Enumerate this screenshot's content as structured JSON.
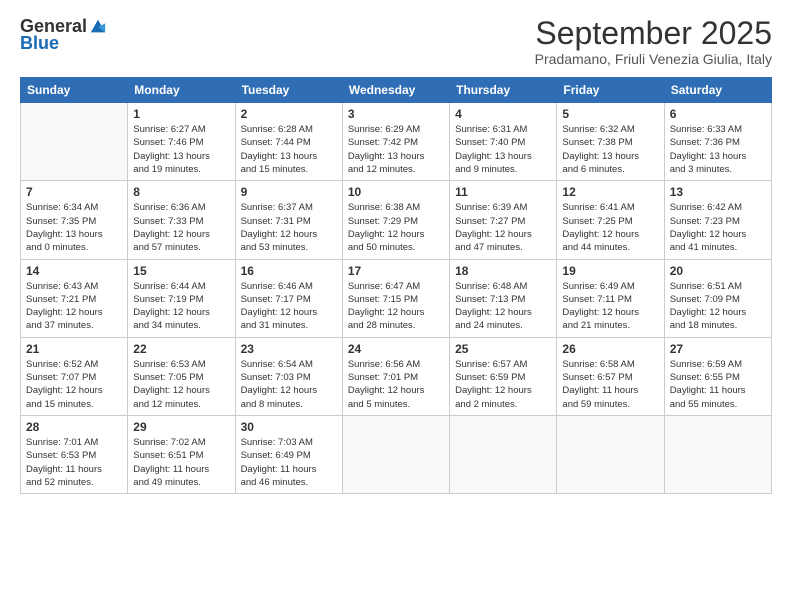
{
  "logo": {
    "general": "General",
    "blue": "Blue"
  },
  "title": "September 2025",
  "subtitle": "Pradamano, Friuli Venezia Giulia, Italy",
  "headers": [
    "Sunday",
    "Monday",
    "Tuesday",
    "Wednesday",
    "Thursday",
    "Friday",
    "Saturday"
  ],
  "weeks": [
    [
      {
        "day": "",
        "info": ""
      },
      {
        "day": "1",
        "info": "Sunrise: 6:27 AM\nSunset: 7:46 PM\nDaylight: 13 hours\nand 19 minutes."
      },
      {
        "day": "2",
        "info": "Sunrise: 6:28 AM\nSunset: 7:44 PM\nDaylight: 13 hours\nand 15 minutes."
      },
      {
        "day": "3",
        "info": "Sunrise: 6:29 AM\nSunset: 7:42 PM\nDaylight: 13 hours\nand 12 minutes."
      },
      {
        "day": "4",
        "info": "Sunrise: 6:31 AM\nSunset: 7:40 PM\nDaylight: 13 hours\nand 9 minutes."
      },
      {
        "day": "5",
        "info": "Sunrise: 6:32 AM\nSunset: 7:38 PM\nDaylight: 13 hours\nand 6 minutes."
      },
      {
        "day": "6",
        "info": "Sunrise: 6:33 AM\nSunset: 7:36 PM\nDaylight: 13 hours\nand 3 minutes."
      }
    ],
    [
      {
        "day": "7",
        "info": "Sunrise: 6:34 AM\nSunset: 7:35 PM\nDaylight: 13 hours\nand 0 minutes."
      },
      {
        "day": "8",
        "info": "Sunrise: 6:36 AM\nSunset: 7:33 PM\nDaylight: 12 hours\nand 57 minutes."
      },
      {
        "day": "9",
        "info": "Sunrise: 6:37 AM\nSunset: 7:31 PM\nDaylight: 12 hours\nand 53 minutes."
      },
      {
        "day": "10",
        "info": "Sunrise: 6:38 AM\nSunset: 7:29 PM\nDaylight: 12 hours\nand 50 minutes."
      },
      {
        "day": "11",
        "info": "Sunrise: 6:39 AM\nSunset: 7:27 PM\nDaylight: 12 hours\nand 47 minutes."
      },
      {
        "day": "12",
        "info": "Sunrise: 6:41 AM\nSunset: 7:25 PM\nDaylight: 12 hours\nand 44 minutes."
      },
      {
        "day": "13",
        "info": "Sunrise: 6:42 AM\nSunset: 7:23 PM\nDaylight: 12 hours\nand 41 minutes."
      }
    ],
    [
      {
        "day": "14",
        "info": "Sunrise: 6:43 AM\nSunset: 7:21 PM\nDaylight: 12 hours\nand 37 minutes."
      },
      {
        "day": "15",
        "info": "Sunrise: 6:44 AM\nSunset: 7:19 PM\nDaylight: 12 hours\nand 34 minutes."
      },
      {
        "day": "16",
        "info": "Sunrise: 6:46 AM\nSunset: 7:17 PM\nDaylight: 12 hours\nand 31 minutes."
      },
      {
        "day": "17",
        "info": "Sunrise: 6:47 AM\nSunset: 7:15 PM\nDaylight: 12 hours\nand 28 minutes."
      },
      {
        "day": "18",
        "info": "Sunrise: 6:48 AM\nSunset: 7:13 PM\nDaylight: 12 hours\nand 24 minutes."
      },
      {
        "day": "19",
        "info": "Sunrise: 6:49 AM\nSunset: 7:11 PM\nDaylight: 12 hours\nand 21 minutes."
      },
      {
        "day": "20",
        "info": "Sunrise: 6:51 AM\nSunset: 7:09 PM\nDaylight: 12 hours\nand 18 minutes."
      }
    ],
    [
      {
        "day": "21",
        "info": "Sunrise: 6:52 AM\nSunset: 7:07 PM\nDaylight: 12 hours\nand 15 minutes."
      },
      {
        "day": "22",
        "info": "Sunrise: 6:53 AM\nSunset: 7:05 PM\nDaylight: 12 hours\nand 12 minutes."
      },
      {
        "day": "23",
        "info": "Sunrise: 6:54 AM\nSunset: 7:03 PM\nDaylight: 12 hours\nand 8 minutes."
      },
      {
        "day": "24",
        "info": "Sunrise: 6:56 AM\nSunset: 7:01 PM\nDaylight: 12 hours\nand 5 minutes."
      },
      {
        "day": "25",
        "info": "Sunrise: 6:57 AM\nSunset: 6:59 PM\nDaylight: 12 hours\nand 2 minutes."
      },
      {
        "day": "26",
        "info": "Sunrise: 6:58 AM\nSunset: 6:57 PM\nDaylight: 11 hours\nand 59 minutes."
      },
      {
        "day": "27",
        "info": "Sunrise: 6:59 AM\nSunset: 6:55 PM\nDaylight: 11 hours\nand 55 minutes."
      }
    ],
    [
      {
        "day": "28",
        "info": "Sunrise: 7:01 AM\nSunset: 6:53 PM\nDaylight: 11 hours\nand 52 minutes."
      },
      {
        "day": "29",
        "info": "Sunrise: 7:02 AM\nSunset: 6:51 PM\nDaylight: 11 hours\nand 49 minutes."
      },
      {
        "day": "30",
        "info": "Sunrise: 7:03 AM\nSunset: 6:49 PM\nDaylight: 11 hours\nand 46 minutes."
      },
      {
        "day": "",
        "info": ""
      },
      {
        "day": "",
        "info": ""
      },
      {
        "day": "",
        "info": ""
      },
      {
        "day": "",
        "info": ""
      }
    ]
  ]
}
